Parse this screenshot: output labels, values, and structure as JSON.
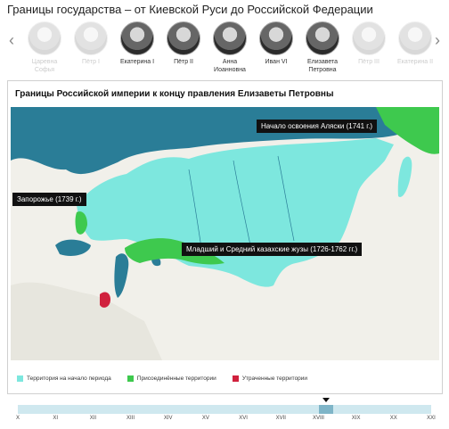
{
  "page": {
    "title": "Границы государства – от Киевской Руси до Российской Федерации"
  },
  "carousel": {
    "prev_icon": "chevron-left-icon",
    "next_icon": "chevron-right-icon",
    "rulers": [
      {
        "name": "Царевна Софья",
        "state": "faded"
      },
      {
        "name": "Пётр I",
        "state": "faded"
      },
      {
        "name": "Екатерина I",
        "state": "normal"
      },
      {
        "name": "Пётр II",
        "state": "normal"
      },
      {
        "name": "Анна Иоанновна",
        "state": "normal"
      },
      {
        "name": "Иван VI",
        "state": "normal"
      },
      {
        "name": "Елизавета Петровна",
        "state": "normal"
      },
      {
        "name": "Пётр III",
        "state": "faded"
      },
      {
        "name": "Екатерина II",
        "state": "faded"
      }
    ]
  },
  "map": {
    "title": "Границы Российской империи к концу правления Елизаветы Петровны",
    "callouts": {
      "alaska": "Начало освоения Аляски (1741 г.)",
      "zaporozhye": "Запорожье (1739 г.)",
      "kazakh": "Младший и Средний казахские жузы (1726-1762 гг.)"
    },
    "colors": {
      "sea": "#2a7d97",
      "land": "#f1f0ea",
      "territory": "#7de7de",
      "annexed": "#3ec94e",
      "lost": "#d0213d"
    }
  },
  "legend": [
    {
      "label": "Территория на начало периода",
      "color": "#7de7de"
    },
    {
      "label": "Присоединённые территории",
      "color": "#3ec94e"
    },
    {
      "label": "Утраченные территории",
      "color": "#d0213d"
    }
  ],
  "timeline": {
    "centuries": [
      "X",
      "XI",
      "XII",
      "XIII",
      "XIV",
      "XV",
      "XVI",
      "XVII",
      "XVIII",
      "XIX",
      "XX",
      "XXI"
    ],
    "active_position": 0.745
  }
}
